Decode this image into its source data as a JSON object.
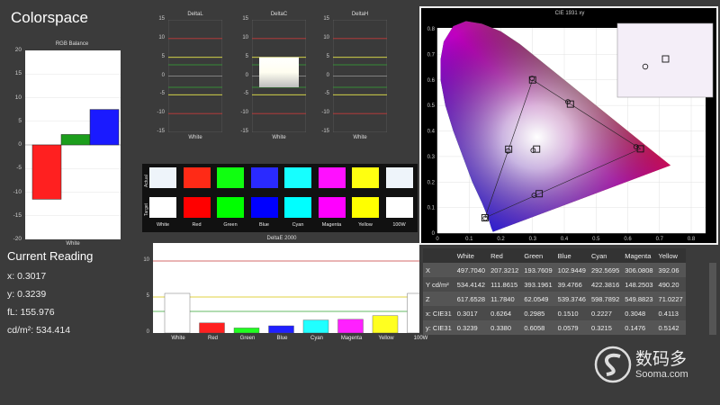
{
  "title": "Colorspace",
  "rgb_balance": {
    "title": "RGB Balance",
    "xlabel": "White",
    "yticks": [
      "20",
      "15",
      "10",
      "5",
      "0",
      "-5",
      "-10",
      "-15",
      "-20"
    ],
    "values": {
      "red": -11.5,
      "green": 2.2,
      "blue": 7.5
    },
    "colors": {
      "red": "#ff2020",
      "green": "#1c9e1c",
      "blue": "#1a1aff"
    }
  },
  "delta_panels": [
    {
      "title": "DeltaL",
      "xlabel": "White"
    },
    {
      "title": "DeltaC",
      "xlabel": "White"
    },
    {
      "title": "DeltaH",
      "xlabel": "White"
    }
  ],
  "delta_yticks": [
    "15",
    "10",
    "5",
    "0",
    "-5",
    "-10",
    "-15"
  ],
  "swatches": {
    "row_actual": "Actual",
    "row_target": "Target",
    "labels": [
      "White",
      "Red",
      "Green",
      "Blue",
      "Cyan",
      "Magenta",
      "Yellow",
      "100W"
    ],
    "actual_colors": [
      "#eef4fa",
      "#ff2a16",
      "#10ff10",
      "#2a2aff",
      "#16ffff",
      "#ff10ff",
      "#ffff10",
      "#eef4fa"
    ],
    "target_colors": [
      "#ffffff",
      "#ff0000",
      "#00ff00",
      "#0000ff",
      "#00ffff",
      "#ff00ff",
      "#ffff00",
      "#ffffff"
    ]
  },
  "deltae": {
    "title": "DeltaE 2000",
    "yticks": [
      "10",
      "5",
      "0"
    ],
    "categories": [
      "White",
      "Red",
      "Green",
      "Blue",
      "Cyan",
      "Magenta",
      "Yellow",
      "100W"
    ],
    "values": [
      5.5,
      1.4,
      0.7,
      1.0,
      1.8,
      1.9,
      2.4,
      5.5
    ],
    "colors": [
      "#ffffff",
      "#ff2020",
      "#20ff20",
      "#2020ff",
      "#20ffff",
      "#ff20ff",
      "#ffff20",
      "#ffffff"
    ]
  },
  "cie": {
    "title": "CIE 1931 xy",
    "xticks": [
      "0",
      "0.1",
      "0.2",
      "0.3",
      "0.4",
      "0.5",
      "0.6",
      "0.7",
      "0.8"
    ],
    "yticks": [
      "0.8",
      "0.7",
      "0.6",
      "0.5",
      "0.4",
      "0.3",
      "0.2",
      "0.1",
      "0"
    ]
  },
  "current_reading": {
    "title": "Current Reading",
    "x": "x: 0.3017",
    "y": "y: 0.3239",
    "fl": "fL: 155.976",
    "cd": "cd/m²: 534.414"
  },
  "color_table": {
    "headers": [
      "",
      "White",
      "Red",
      "Green",
      "Blue",
      "Cyan",
      "Magenta",
      "Yellow"
    ],
    "rows": [
      [
        "X",
        "497.7040",
        "207.3212",
        "193.7609",
        "102.9449",
        "292.5695",
        "306.0808",
        "392.06"
      ],
      [
        "Y cd/m²",
        "534.4142",
        "111.8615",
        "393.1961",
        "39.4766",
        "422.3816",
        "148.2503",
        "490.20"
      ],
      [
        "Z",
        "617.6528",
        "11.7840",
        "62.0549",
        "539.3746",
        "598.7892",
        "549.8823",
        "71.0227"
      ],
      [
        "x: CIE31",
        "0.3017",
        "0.6264",
        "0.2985",
        "0.1510",
        "0.2227",
        "0.3048",
        "0.4113"
      ],
      [
        "y: CIE31",
        "0.3239",
        "0.3380",
        "0.6058",
        "0.0579",
        "0.3215",
        "0.1476",
        "0.5142"
      ]
    ]
  },
  "watermark": {
    "brand": "数码多",
    "site": "Sooma.com"
  }
}
